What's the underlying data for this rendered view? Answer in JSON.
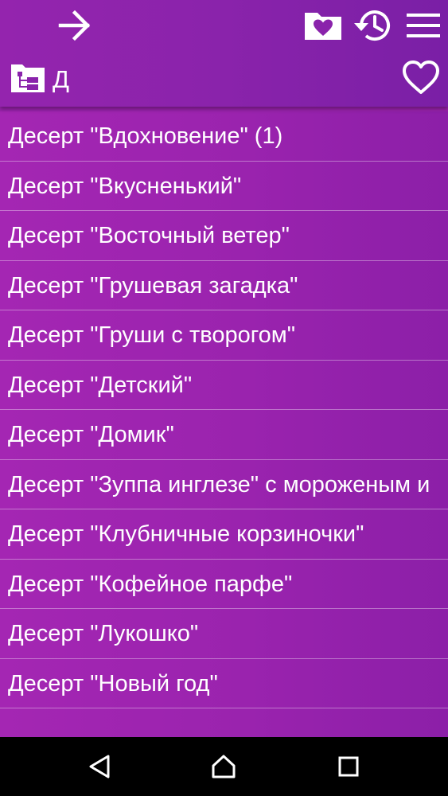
{
  "header": {
    "breadcrumb": "Д"
  },
  "icons": {
    "back": "arrow-right-icon",
    "favorites_folder": "folder-heart-icon",
    "history": "history-icon",
    "menu": "hamburger-menu-icon",
    "tree": "folder-tree-icon",
    "favorite": "heart-outline-icon"
  },
  "colors": {
    "appbar": "#8a23ab",
    "list_background": "#9a23ae",
    "text": "#ffffff",
    "divider": "#c98bd6",
    "navbar": "#000000"
  },
  "items": [
    "Десерт \"Вдохновение\" (1)",
    "Десерт \"Вкусненький\"",
    "Десерт \"Восточный ветер\"",
    "Десерт \"Грушевая загадка\"",
    "Десерт \"Груши с творогом\"",
    "Десерт \"Детский\"",
    "Десерт \"Домик\"",
    "Десерт \"Зуппа инглезе\" с мороженым и",
    "Десерт \"Клубничные корзиночки\"",
    "Десерт \"Кофейное парфе\"",
    "Десерт \"Лукошко\"",
    "Десерт \"Новый год\"",
    ""
  ]
}
